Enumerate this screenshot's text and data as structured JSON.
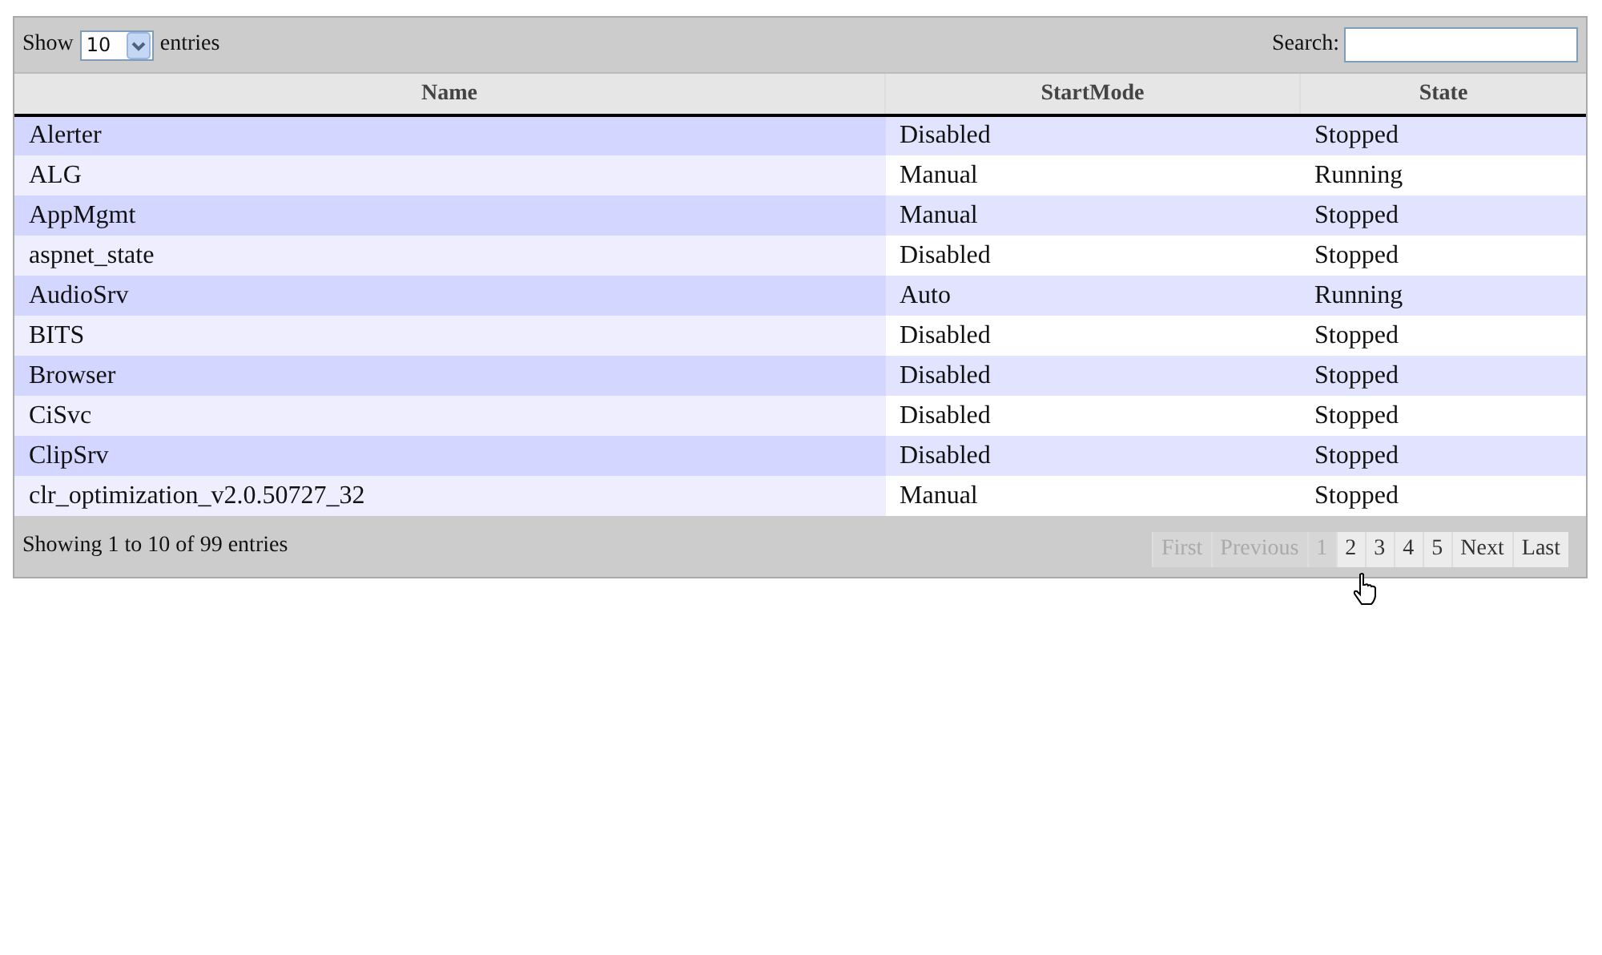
{
  "length_control": {
    "label_before": "Show",
    "value": "10",
    "label_after": "entries"
  },
  "search": {
    "label": "Search:"
  },
  "table": {
    "columns": [
      {
        "label": "Name",
        "sorted": true
      },
      {
        "label": "StartMode",
        "sorted": false
      },
      {
        "label": "State",
        "sorted": false
      }
    ],
    "rows": [
      [
        "Alerter",
        "Disabled",
        "Stopped"
      ],
      [
        "ALG",
        "Manual",
        "Running"
      ],
      [
        "AppMgmt",
        "Manual",
        "Stopped"
      ],
      [
        "aspnet_state",
        "Disabled",
        "Stopped"
      ],
      [
        "AudioSrv",
        "Auto",
        "Running"
      ],
      [
        "BITS",
        "Disabled",
        "Stopped"
      ],
      [
        "Browser",
        "Disabled",
        "Stopped"
      ],
      [
        "CiSvc",
        "Disabled",
        "Stopped"
      ],
      [
        "ClipSrv",
        "Disabled",
        "Stopped"
      ],
      [
        "clr_optimization_v2.0.50727_32",
        "Manual",
        "Stopped"
      ]
    ]
  },
  "info": "Showing 1 to 10 of 99 entries",
  "pagination": [
    {
      "label": "First",
      "disabled": true
    },
    {
      "label": "Previous",
      "disabled": true
    },
    {
      "label": "1",
      "disabled": true
    },
    {
      "label": "2",
      "disabled": false
    },
    {
      "label": "3",
      "disabled": false
    },
    {
      "label": "4",
      "disabled": false
    },
    {
      "label": "5",
      "disabled": false
    },
    {
      "label": "Next",
      "disabled": false
    },
    {
      "label": "Last",
      "disabled": false
    }
  ]
}
